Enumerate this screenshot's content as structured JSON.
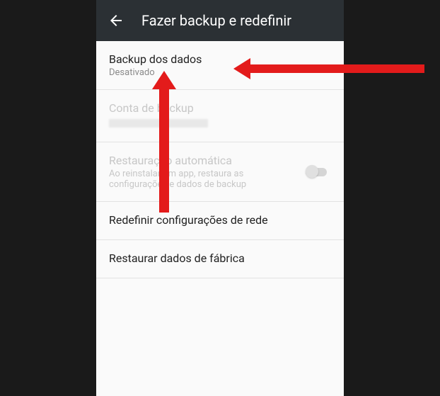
{
  "header": {
    "title": "Fazer backup e redefinir"
  },
  "items": {
    "backup_data": {
      "title": "Backup dos dados",
      "subtitle": "Desativado"
    },
    "backup_account": {
      "title": "Conta de backup"
    },
    "auto_restore": {
      "title": "Restauração automática",
      "subtitle": "Ao reinstalar um app, restaura as configurações e dados de backup"
    },
    "reset_network": {
      "title": "Redefinir configurações de rede"
    },
    "factory_reset": {
      "title": "Restaurar dados de fábrica"
    }
  }
}
